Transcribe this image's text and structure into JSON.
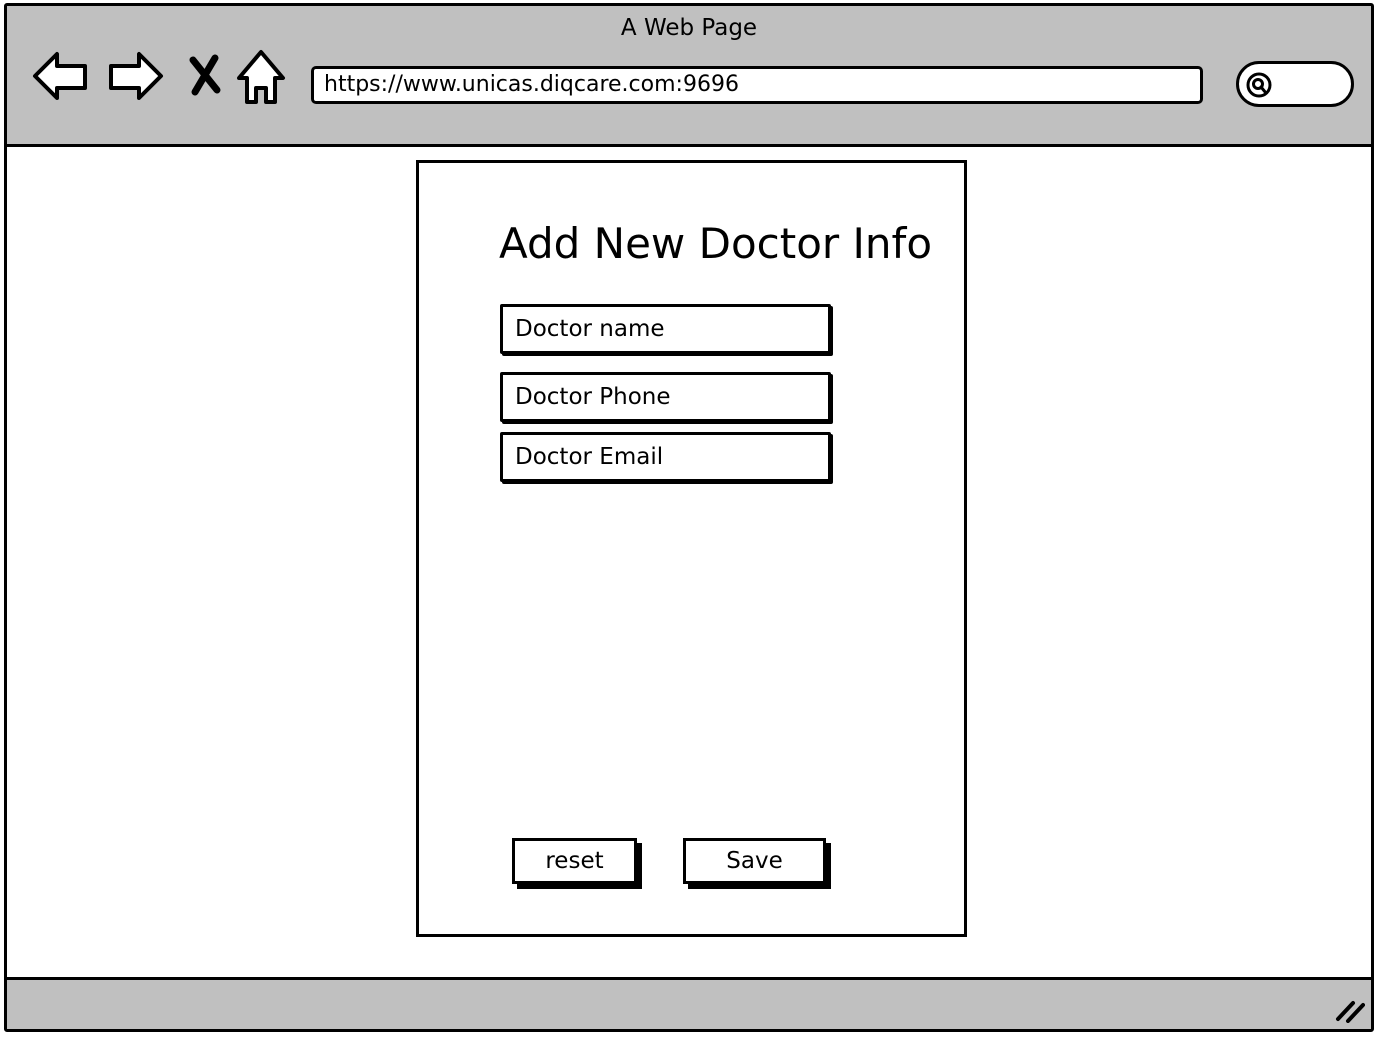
{
  "window": {
    "title": "A Web Page"
  },
  "toolbar": {
    "back_icon": "back-arrow-icon",
    "forward_icon": "forward-arrow-icon",
    "stop_icon": "close-icon",
    "home_icon": "home-icon",
    "search_icon": "search-icon"
  },
  "address_bar": {
    "url": "https://www.unicas.diqcare.com:9696"
  },
  "form": {
    "title": "Add New Doctor Info",
    "fields": [
      {
        "placeholder": "Doctor name"
      },
      {
        "placeholder": "Doctor Phone"
      },
      {
        "placeholder": "Doctor Email"
      }
    ],
    "reset_label": "reset",
    "save_label": "Save"
  },
  "colors": {
    "chrome": "#c0c0c0",
    "ink": "#000000",
    "paper": "#ffffff"
  }
}
